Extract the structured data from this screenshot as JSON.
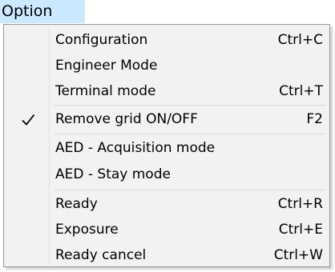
{
  "menubar": {
    "title": "Option"
  },
  "menu": {
    "items": [
      {
        "label": "Configuration",
        "shortcut": "Ctrl+C",
        "checked": false
      },
      {
        "label": "Engineer Mode",
        "shortcut": "",
        "checked": false
      },
      {
        "label": "Terminal mode",
        "shortcut": "Ctrl+T",
        "checked": false
      },
      {
        "label": "Remove grid ON/OFF",
        "shortcut": "F2",
        "checked": true
      },
      {
        "label": "AED - Acquisition mode",
        "shortcut": "",
        "checked": false
      },
      {
        "label": "AED - Stay mode",
        "shortcut": "",
        "checked": false
      },
      {
        "label": "Ready",
        "shortcut": "Ctrl+R",
        "checked": false
      },
      {
        "label": "Exposure",
        "shortcut": "Ctrl+E",
        "checked": false
      },
      {
        "label": "Ready cancel",
        "shortcut": "Ctrl+W",
        "checked": false
      }
    ]
  },
  "colors": {
    "menubar_highlight": "#cce8ff",
    "menu_background": "#f2f2f2",
    "menu_border": "#979797"
  },
  "icons": {
    "checked_item": "checkmark-icon"
  }
}
